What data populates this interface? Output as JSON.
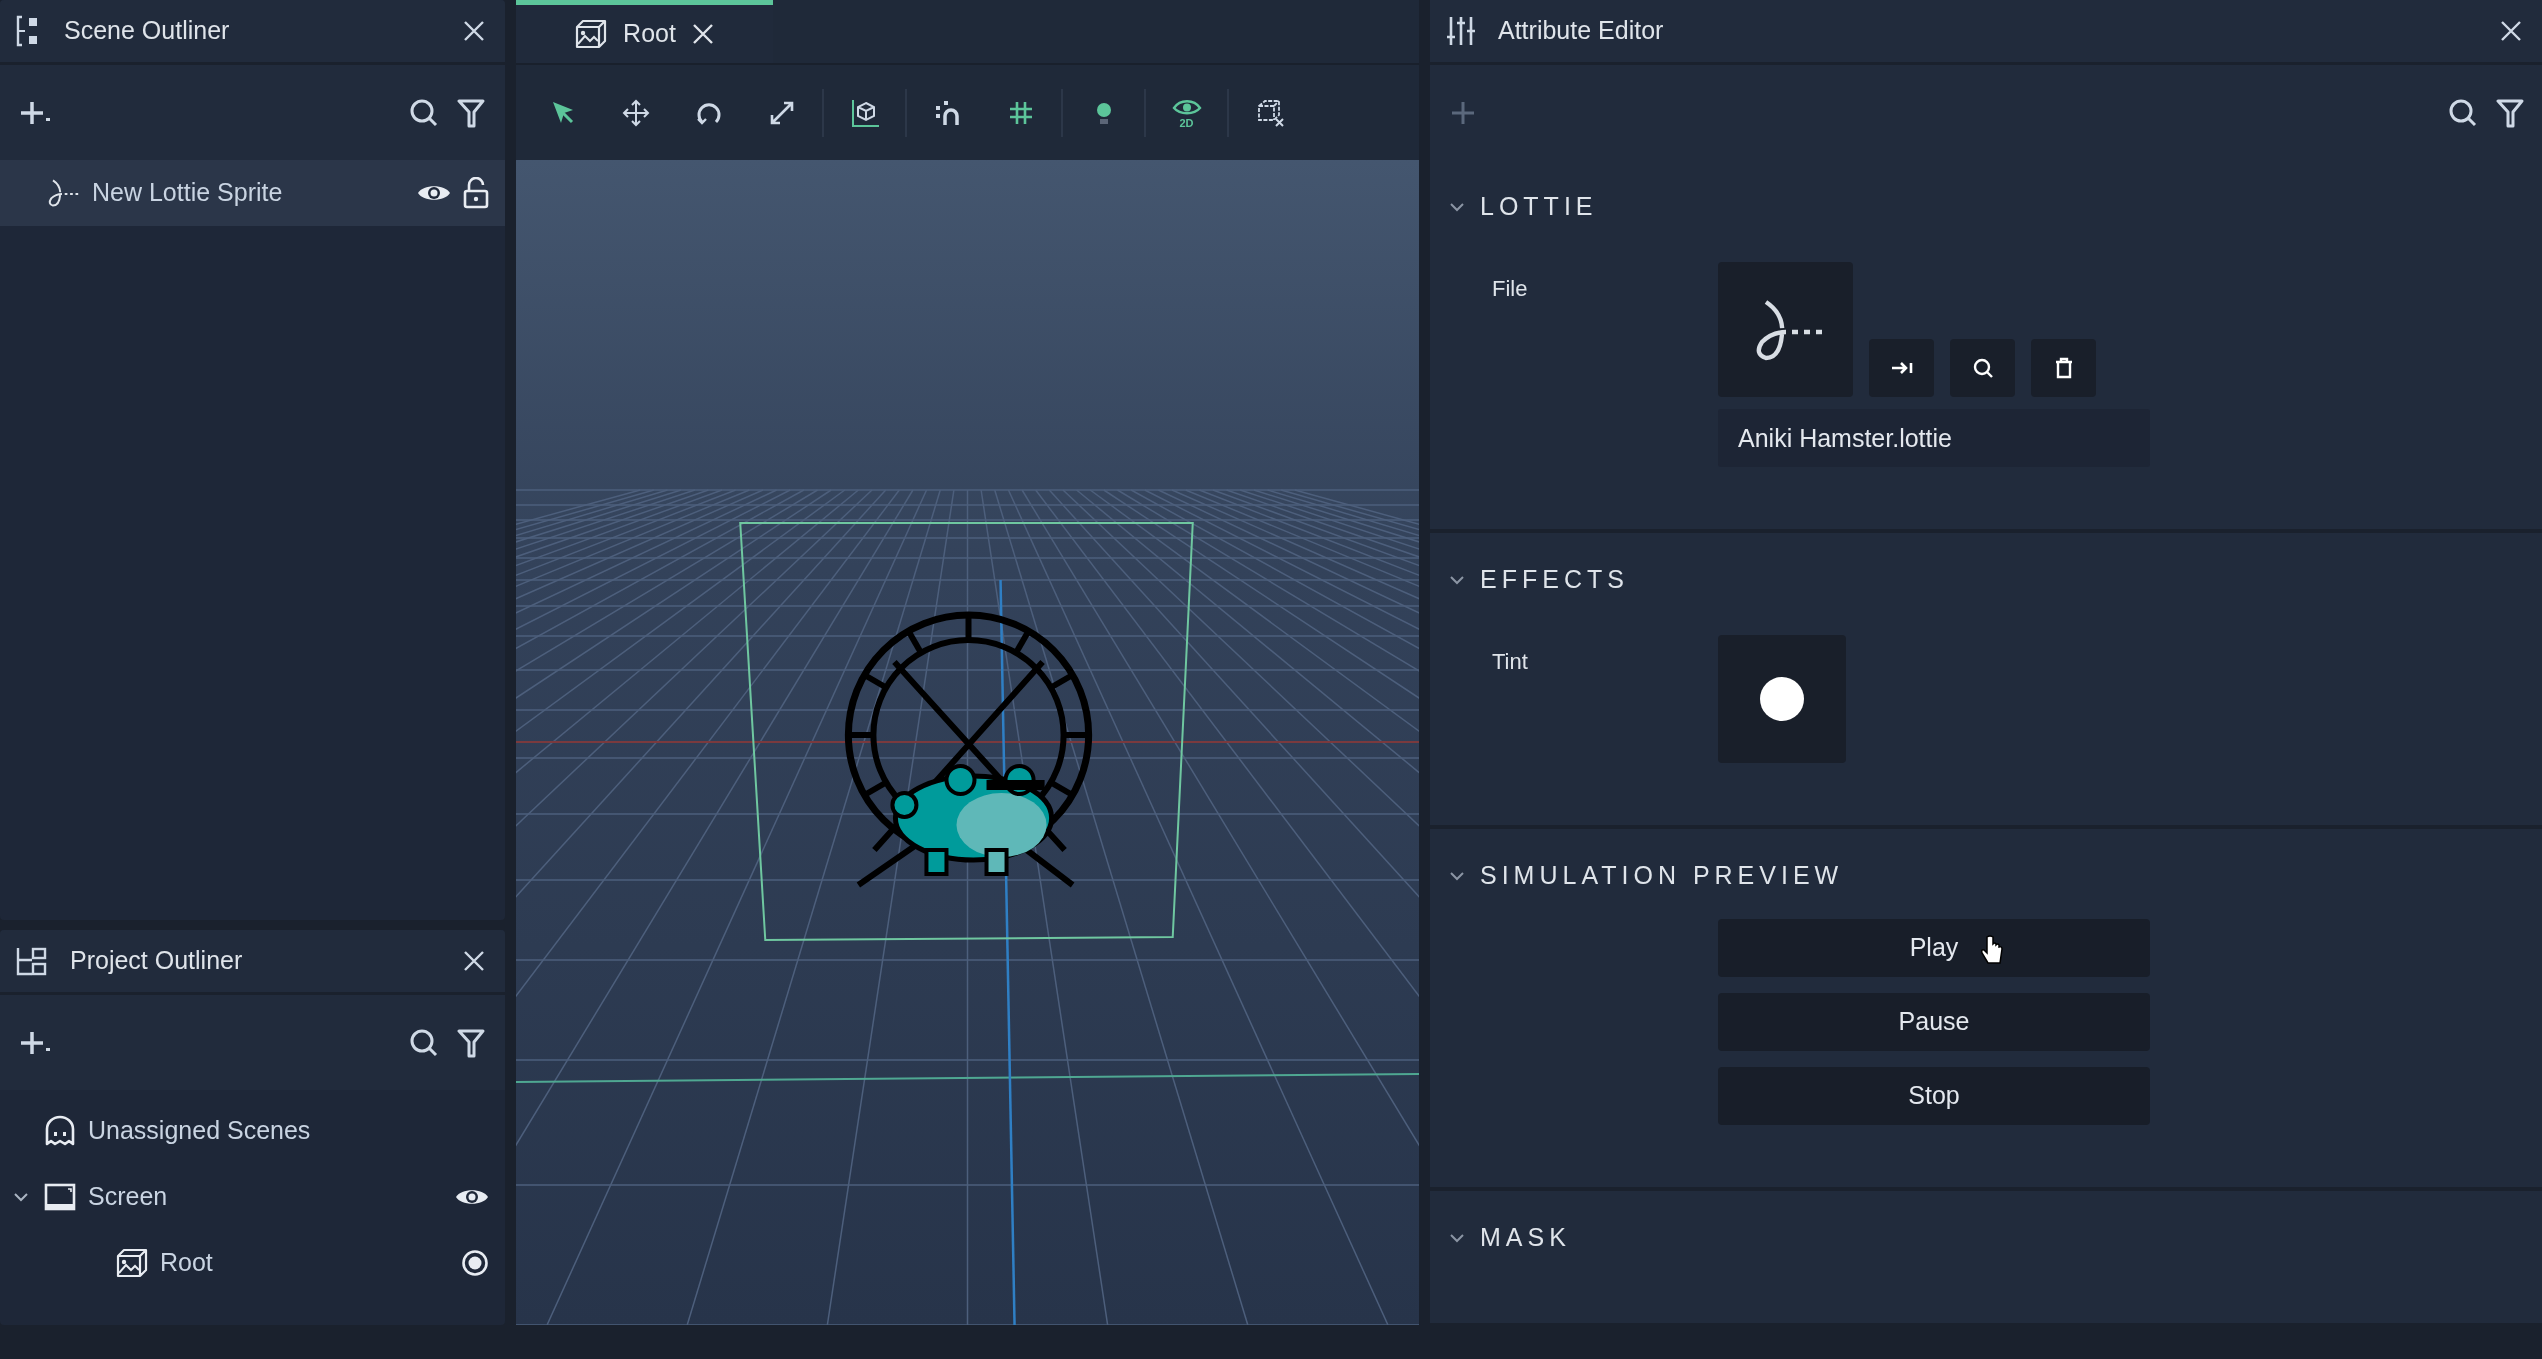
{
  "scene_outliner": {
    "title": "Scene Outliner",
    "items": [
      {
        "label": "New Lottie Sprite",
        "kind": "lottie",
        "selected": true
      }
    ]
  },
  "viewport": {
    "tabs": [
      {
        "label": "Root",
        "selected": true
      }
    ],
    "tools": [
      {
        "kind": "select",
        "active": true
      },
      {
        "kind": "move",
        "active": false
      },
      {
        "kind": "rotate",
        "active": false
      },
      {
        "kind": "scale",
        "active": false
      },
      {
        "kind": "axes",
        "active": true,
        "divider_before": true
      },
      {
        "kind": "snap",
        "active": false,
        "divider_before": true
      },
      {
        "kind": "grid",
        "active": true
      },
      {
        "kind": "light",
        "active": true,
        "divider_before": true
      },
      {
        "kind": "view2d",
        "active": true,
        "label": "2D",
        "divider_before": true
      },
      {
        "kind": "boxoff",
        "active": false,
        "divider_before": true
      }
    ]
  },
  "project_outliner": {
    "title": "Project Outliner",
    "items": [
      {
        "label": "Unassigned Scenes",
        "kind": "ghost"
      },
      {
        "label": "Screen",
        "kind": "screen",
        "expanded": true,
        "children": [
          {
            "label": "Root",
            "kind": "scene"
          }
        ]
      }
    ]
  },
  "attribute_editor": {
    "title": "Attribute Editor",
    "sections": [
      {
        "title": "LOTTIE",
        "expanded": true,
        "kind": "file",
        "label": "File",
        "value": "Aniki Hamster.lottie"
      },
      {
        "title": "EFFECTS",
        "expanded": true,
        "kind": "color",
        "label": "Tint",
        "color": "#ffffff"
      },
      {
        "title": "SIMULATION PREVIEW",
        "expanded": true,
        "kind": "buttons",
        "buttons": [
          "Play",
          "Pause",
          "Stop"
        ]
      },
      {
        "title": "MASK",
        "expanded": true,
        "kind": "empty"
      }
    ]
  }
}
